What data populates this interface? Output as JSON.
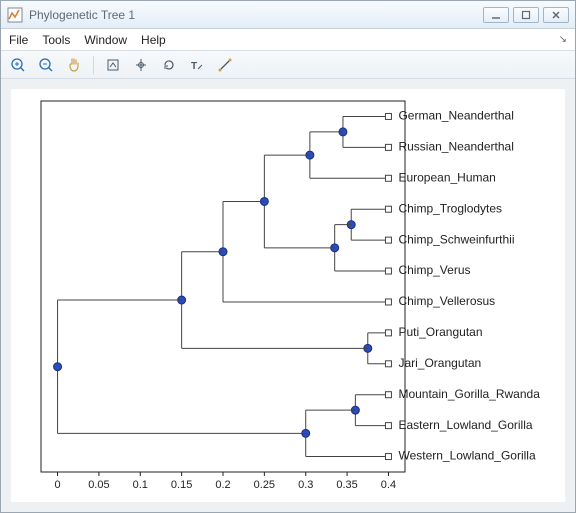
{
  "window": {
    "title": "Phylogenetic Tree 1"
  },
  "menu": {
    "file": "File",
    "tools": "Tools",
    "window": "Window",
    "help": "Help"
  },
  "chart_data": {
    "type": "dendrogram",
    "xlabel": "",
    "ylabel": "",
    "xlim": [
      -0.02,
      0.42
    ],
    "x_ticks": [
      0,
      0.05,
      0.1,
      0.15,
      0.2,
      0.25,
      0.3,
      0.35,
      0.4
    ],
    "x_tick_labels": [
      "0",
      "0.05",
      "0.1",
      "0.15",
      "0.2",
      "0.25",
      "0.3",
      "0.35",
      "0.4"
    ],
    "leaves": [
      {
        "name": "German_Neanderthal",
        "x": 0.4
      },
      {
        "name": "Russian_Neanderthal",
        "x": 0.4
      },
      {
        "name": "European_Human",
        "x": 0.4
      },
      {
        "name": "Chimp_Troglodytes",
        "x": 0.4
      },
      {
        "name": "Chimp_Schweinfurthii",
        "x": 0.4
      },
      {
        "name": "Chimp_Verus",
        "x": 0.4
      },
      {
        "name": "Chimp_Vellerosus",
        "x": 0.4
      },
      {
        "name": "Puti_Orangutan",
        "x": 0.4
      },
      {
        "name": "Jari_Orangutan",
        "x": 0.4
      },
      {
        "name": "Mountain_Gorilla_Rwanda",
        "x": 0.4
      },
      {
        "name": "Eastern_Lowland_Gorilla",
        "x": 0.4
      },
      {
        "name": "Western_Lowland_Gorilla",
        "x": 0.4
      }
    ],
    "internal_nodes": [
      {
        "id": "n_gerrus",
        "x": 0.345,
        "children": [
          "German_Neanderthal",
          "Russian_Neanderthal"
        ]
      },
      {
        "id": "n_neand_eu",
        "x": 0.305,
        "children": [
          "n_gerrus",
          "European_Human"
        ]
      },
      {
        "id": "n_chimp_ts",
        "x": 0.355,
        "children": [
          "Chimp_Troglodytes",
          "Chimp_Schweinfurthii"
        ]
      },
      {
        "id": "n_chimp_tsv",
        "x": 0.335,
        "children": [
          "n_chimp_ts",
          "Chimp_Verus"
        ]
      },
      {
        "id": "n_human_chimp",
        "x": 0.25,
        "children": [
          "n_neand_eu",
          "n_chimp_tsv"
        ]
      },
      {
        "id": "n_hc_vell",
        "x": 0.2,
        "children": [
          "n_human_chimp",
          "Chimp_Vellerosus"
        ]
      },
      {
        "id": "n_orang",
        "x": 0.375,
        "children": [
          "Puti_Orangutan",
          "Jari_Orangutan"
        ]
      },
      {
        "id": "n_hcv_orang",
        "x": 0.15,
        "children": [
          "n_hc_vell",
          "n_orang"
        ]
      },
      {
        "id": "n_gor_me",
        "x": 0.36,
        "children": [
          "Mountain_Gorilla_Rwanda",
          "Eastern_Lowland_Gorilla"
        ]
      },
      {
        "id": "n_gor",
        "x": 0.3,
        "children": [
          "n_gor_me",
          "Western_Lowland_Gorilla"
        ]
      },
      {
        "id": "n_root",
        "x": 0.0,
        "children": [
          "n_hcv_orang",
          "n_gor"
        ]
      }
    ]
  }
}
